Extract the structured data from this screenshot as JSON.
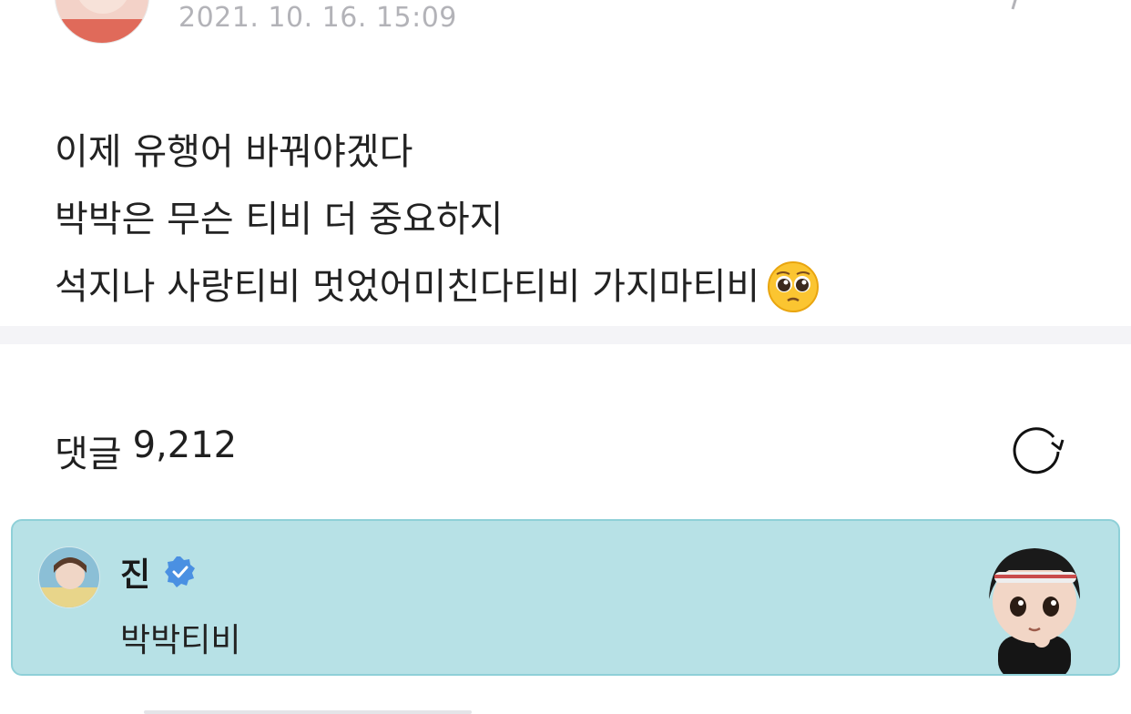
{
  "post": {
    "timestamp": "2021. 10. 16. 15:09",
    "lines": [
      "이제 유행어 바꿔야겠다",
      "박박은 무슨 티비 더 중요하지",
      "석지나 사랑티비 멋었어미친다티비 가지마티비"
    ],
    "emoji": "pleading-face"
  },
  "comments": {
    "label": "댓글",
    "count": "9,212"
  },
  "artist_comment": {
    "name": "진",
    "text": "박박티비"
  },
  "colors": {
    "card_bg": "#b7e1e6",
    "card_border": "#8fd0d8",
    "verified": "#4a90e2",
    "timestamp": "#b3b3b8"
  }
}
